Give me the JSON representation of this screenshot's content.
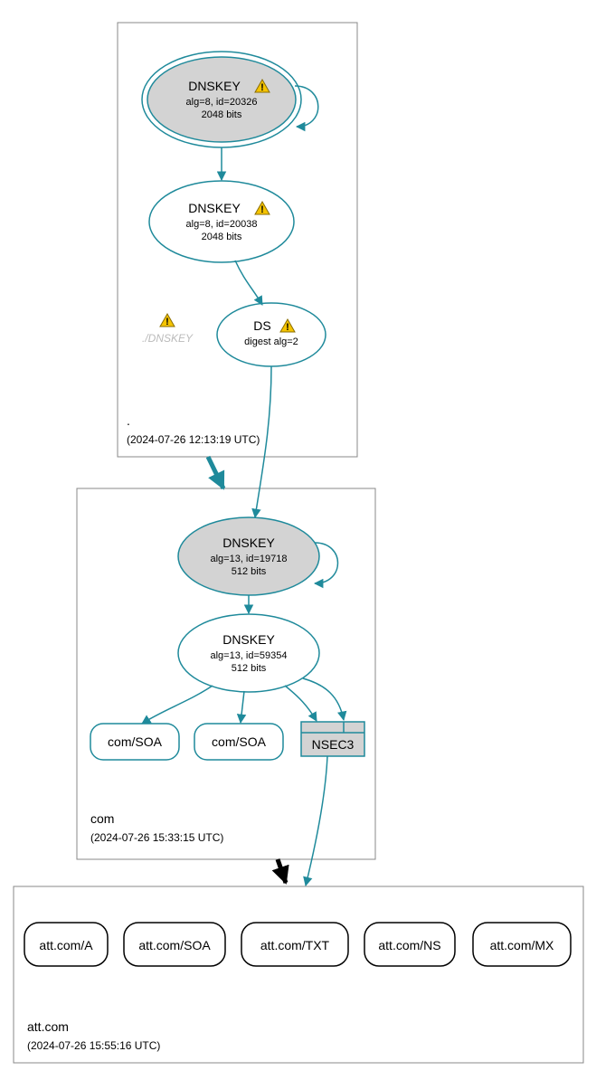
{
  "colors": {
    "teal": "#1f8a9b",
    "grey_fill": "#d3d3d3",
    "box_stroke": "#888888",
    "ghost": "#bbbbbb"
  },
  "zones": {
    "root": {
      "label": ".",
      "timestamp": "(2024-07-26 12:13:19 UTC)"
    },
    "com": {
      "label": "com",
      "timestamp": "(2024-07-26 15:33:15 UTC)"
    },
    "att": {
      "label": "att.com",
      "timestamp": "(2024-07-26 15:55:16 UTC)"
    }
  },
  "nodes": {
    "root_ksk": {
      "title": "DNSKEY",
      "line2": "alg=8, id=20326",
      "line3": "2048 bits"
    },
    "root_zsk": {
      "title": "DNSKEY",
      "line2": "alg=8, id=20038",
      "line3": "2048 bits"
    },
    "root_ds": {
      "title": "DS",
      "line2": "digest alg=2"
    },
    "root_ghost": {
      "label": "./DNSKEY"
    },
    "com_ksk": {
      "title": "DNSKEY",
      "line2": "alg=13, id=19718",
      "line3": "512 bits"
    },
    "com_zsk": {
      "title": "DNSKEY",
      "line2": "alg=13, id=59354",
      "line3": "512 bits"
    },
    "com_soa1": {
      "label": "com/SOA"
    },
    "com_soa2": {
      "label": "com/SOA"
    },
    "com_nsec3": {
      "label": "NSEC3"
    },
    "att_a": {
      "label": "att.com/A"
    },
    "att_soa": {
      "label": "att.com/SOA"
    },
    "att_txt": {
      "label": "att.com/TXT"
    },
    "att_ns": {
      "label": "att.com/NS"
    },
    "att_mx": {
      "label": "att.com/MX"
    }
  }
}
